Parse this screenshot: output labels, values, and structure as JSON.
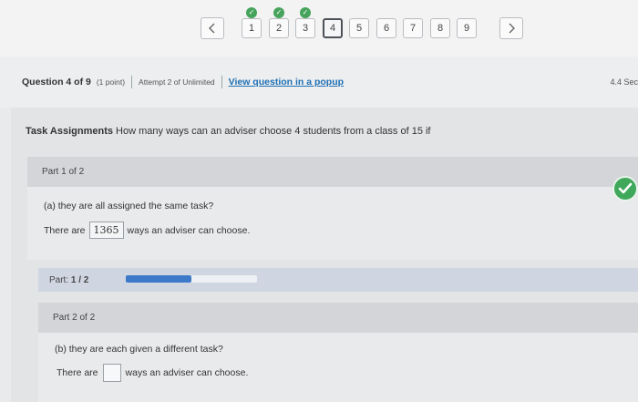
{
  "nav": {
    "prev_icon": "chevron-left-icon",
    "next_icon": "chevron-right-icon",
    "questions": [
      {
        "label": "1",
        "completed": true
      },
      {
        "label": "2",
        "completed": true
      },
      {
        "label": "3",
        "completed": true
      },
      {
        "label": "4",
        "completed": false,
        "current": true
      },
      {
        "label": "5",
        "completed": false
      },
      {
        "label": "6",
        "completed": false
      },
      {
        "label": "7",
        "completed": false
      },
      {
        "label": "8",
        "completed": false
      },
      {
        "label": "9",
        "completed": false
      }
    ]
  },
  "header": {
    "question_label": "Question 4 of 9",
    "points": "(1 point)",
    "attempt": "Attempt 2 of Unlimited",
    "popup_link": "View question in a popup",
    "score_right": "4.4 Sec"
  },
  "task": {
    "title": "Task Assignments",
    "text": "How many ways can an adviser choose 4 students from a class of 15 if"
  },
  "part1": {
    "heading": "Part 1 of 2",
    "question": "(a) they are all assigned the same task?",
    "answer_prefix": "There are",
    "answer_value": "1365",
    "answer_suffix": "ways an adviser can choose.",
    "status_icon": "checkmark-icon"
  },
  "progress": {
    "label": "Part:",
    "value": "1 / 2",
    "fraction": 0.5
  },
  "part2": {
    "heading": "Part 2 of 2",
    "question": "(b) they are each given a different task?",
    "answer_prefix": "There are",
    "answer_value": "",
    "answer_suffix": "ways an adviser can choose."
  },
  "colors": {
    "accent_blue": "#3d79c9",
    "check_green": "#3fa85a",
    "link_blue": "#1f6fb4"
  }
}
